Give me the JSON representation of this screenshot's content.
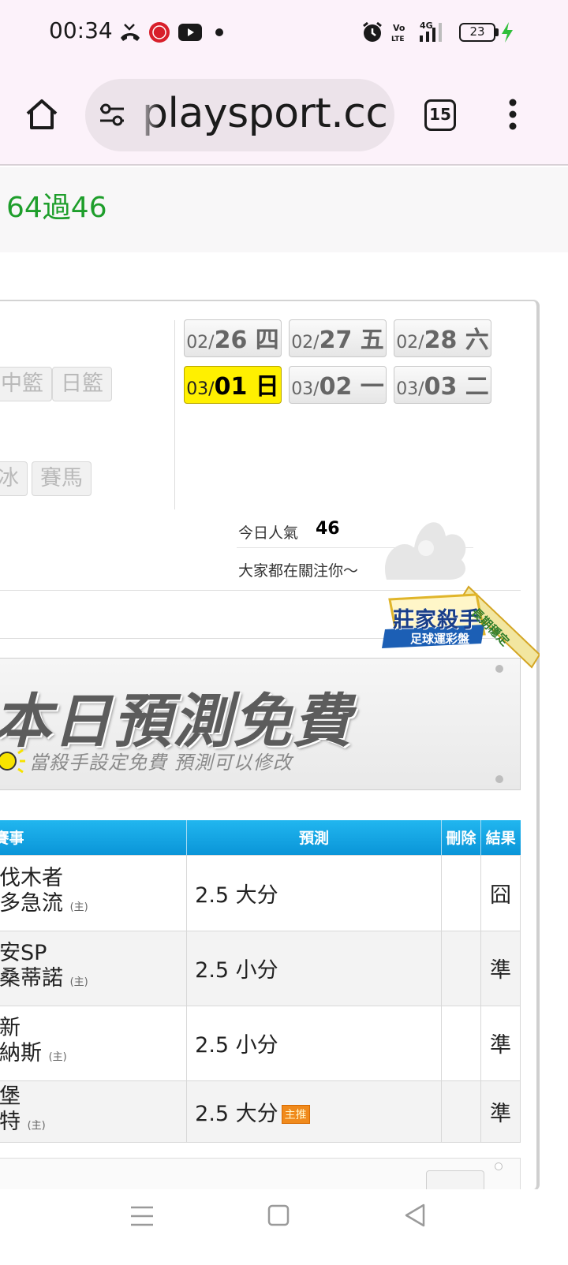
{
  "status_bar": {
    "time": "00:34",
    "battery": "23",
    "icons": [
      "missed-call-icon",
      "app-badge-icon",
      "youtube-icon",
      "dot-icon",
      "alarm-icon",
      "volte-icon",
      "signal-4g-icon",
      "battery-icon",
      "charging-icon"
    ]
  },
  "browser": {
    "url": "playsport.cc",
    "tab_count": "15",
    "icons": [
      "home-icon",
      "site-settings-icon",
      "menu-icon"
    ]
  },
  "page": {
    "summary": "64過46",
    "tags_row1": [
      "中籃",
      "日籃"
    ],
    "tags_row2": [
      "冰",
      "賽馬"
    ],
    "dates": [
      {
        "month": "02/",
        "day": "26 四",
        "active": false
      },
      {
        "month": "02/",
        "day": "27 五",
        "active": false
      },
      {
        "month": "02/",
        "day": "28 六",
        "active": false
      },
      {
        "month": "03/",
        "day": "01 日",
        "active": true
      },
      {
        "month": "03/",
        "day": "02 一",
        "active": false
      },
      {
        "month": "03/",
        "day": "03 二",
        "active": false
      }
    ],
    "popularity_label": "今日人氣",
    "popularity_value": "46",
    "popularity_note": "大家都在關注你～",
    "badge": {
      "title": "莊家殺手",
      "subtitle": "足球運彩盤",
      "ribbon": "長期穩定"
    },
    "banner": {
      "title": "本日預測免費",
      "subtitle": "當殺手設定免費 預測可以修改"
    },
    "table": {
      "headers": [
        "賽事",
        "預測",
        "刪除",
        "結果"
      ],
      "host_mark": "(主)",
      "zhu_tag": "主推",
      "rows": [
        {
          "team1": "伐木者",
          "team2": "多急流",
          "prediction": "2.5 大分",
          "result": "囧",
          "zhu": false
        },
        {
          "team1": "安SP",
          "team2": "桑蒂諾",
          "prediction": "2.5 小分",
          "result": "準",
          "zhu": false
        },
        {
          "team1": "新",
          "team2": "納斯",
          "prediction": "2.5 小分",
          "result": "準",
          "zhu": false
        },
        {
          "team1": "堡",
          "team2": "特",
          "prediction": "2.5 大分",
          "result": "準",
          "zhu": true
        }
      ]
    }
  },
  "nav": {
    "icons": [
      "recent-apps-icon",
      "home-nav-icon",
      "back-icon"
    ]
  }
}
